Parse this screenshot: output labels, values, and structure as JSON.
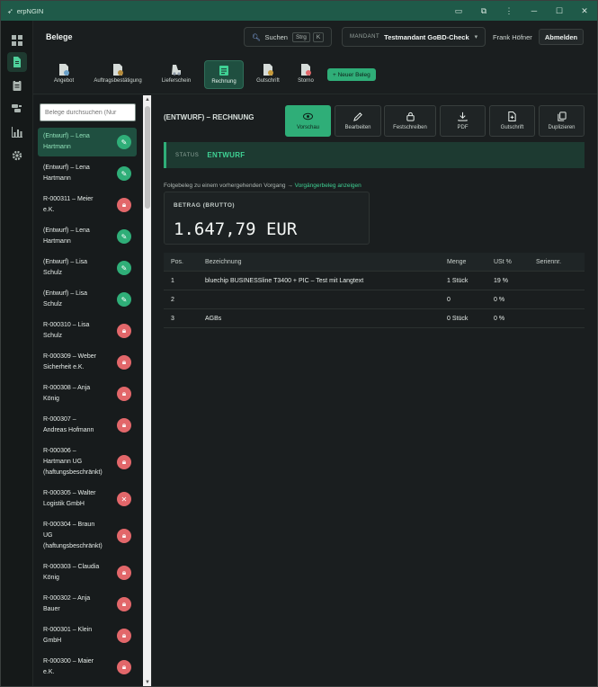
{
  "window": {
    "app_title": "erpNGIN",
    "controls": [
      "minimize",
      "maximize",
      "close"
    ]
  },
  "rail": {
    "items": [
      {
        "icon": "dashboard-icon"
      },
      {
        "icon": "document-icon",
        "active": true
      },
      {
        "icon": "clipboard-icon"
      },
      {
        "icon": "database-icon"
      },
      {
        "icon": "chart-icon"
      },
      {
        "icon": "gear-icon"
      }
    ]
  },
  "header": {
    "page_title": "Belege",
    "search": {
      "label": "Suchen",
      "shortcut_mod": "Strg",
      "shortcut_key": "K"
    },
    "mandant": {
      "label": "MANDANT",
      "value": "Testmandant GoBD-Check",
      "caret": "▾"
    },
    "user": "Frank Höfner",
    "logout": "Abmelden"
  },
  "doc_types": {
    "items": [
      {
        "label": "Angebot",
        "color": "#6aa0c8"
      },
      {
        "label": "Auftragsbestätigung",
        "color": "#b48a3a"
      },
      {
        "label": "Lieferschein",
        "color": "#8f9aa7"
      },
      {
        "label": "Rechnung",
        "color": "#3fd194",
        "active": true
      },
      {
        "label": "Gutschrift",
        "color": "#c79a3a"
      },
      {
        "label": "Storno",
        "color": "#e2676a"
      }
    ],
    "new_button": "+ Neuer Beleg"
  },
  "list": {
    "search_placeholder": "Belege durchsuchen (Nur",
    "items": [
      {
        "l1": "(Entwurf) – Lena",
        "l2": "Hartmann",
        "l3": "",
        "status": "edit",
        "selected": true
      },
      {
        "l1": "(Entwurf) – Lena",
        "l2": "Hartmann",
        "l3": "",
        "status": "edit"
      },
      {
        "l1": "R-000311 – Meier",
        "l2": "e.K.",
        "l3": "",
        "status": "lock"
      },
      {
        "l1": "(Entwurf) – Lena",
        "l2": "Hartmann",
        "l3": "",
        "status": "edit"
      },
      {
        "l1": "(Entwurf) – Lisa",
        "l2": "Schulz",
        "l3": "",
        "status": "edit"
      },
      {
        "l1": "(Entwurf) – Lisa",
        "l2": "Schulz",
        "l3": "",
        "status": "edit"
      },
      {
        "l1": "R-000310 – Lisa",
        "l2": "Schulz",
        "l3": "",
        "status": "lock"
      },
      {
        "l1": "R-000309 – Weber",
        "l2": "Sicherheit e.K.",
        "l3": "",
        "status": "lock"
      },
      {
        "l1": "R-000308 – Anja",
        "l2": "König",
        "l3": "",
        "status": "lock"
      },
      {
        "l1": "R-000307 –",
        "l2": "Andreas Hofmann",
        "l3": "",
        "status": "lock"
      },
      {
        "l1": "R-000306 –",
        "l2": "Hartmann UG",
        "l3": "(haftungsbeschränkt)",
        "status": "lock"
      },
      {
        "l1": "R-000305 – Walter",
        "l2": "Logistik GmbH",
        "l3": "",
        "status": "cancel"
      },
      {
        "l1": "R-000304 – Braun",
        "l2": "UG",
        "l3": "(haftungsbeschränkt)",
        "status": "lock"
      },
      {
        "l1": "R-000303 – Claudia",
        "l2": "König",
        "l3": "",
        "status": "lock"
      },
      {
        "l1": "R-000302 – Anja",
        "l2": "Bauer",
        "l3": "",
        "status": "lock"
      },
      {
        "l1": "R-000301 – Klein",
        "l2": "GmbH",
        "l3": "",
        "status": "lock"
      },
      {
        "l1": "R-000300 – Maier",
        "l2": "e.K.",
        "l3": "",
        "status": "lock"
      }
    ]
  },
  "main": {
    "title": "(ENTWURF) – RECHNUNG",
    "actions": [
      {
        "label": "Vorschau",
        "icon": "eye-icon",
        "primary": true
      },
      {
        "label": "Bearbeiten",
        "icon": "pencil-icon"
      },
      {
        "label": "Festschreiben",
        "icon": "lock-icon"
      },
      {
        "label": "PDF",
        "icon": "download-icon"
      },
      {
        "label": "Gutschrift",
        "icon": "file-plus-icon"
      },
      {
        "label": "Duplizieren",
        "icon": "copy-icon"
      }
    ],
    "status": {
      "label": "STATUS",
      "value": "ENTWURF"
    },
    "followup": {
      "text": "Folgebeleg zu einem vorhergehenden Vorgang →",
      "link": "Vorgängerbeleg anzeigen"
    },
    "amount": {
      "label": "BETRAG (BRUTTO)",
      "value": "1.647,79 EUR"
    },
    "table": {
      "headers": [
        "Pos.",
        "Bezeichnung",
        "Menge",
        "USt %",
        "Seriennr."
      ],
      "rows": [
        [
          "1",
          "bluechip BUSINESSline T3400 + PIC – Test mit Langtext",
          "1 Stück",
          "19 %",
          ""
        ],
        [
          "2",
          "",
          "0",
          "0 %",
          ""
        ],
        [
          "3",
          "AGBs",
          "0 Stück",
          "0 %",
          ""
        ]
      ]
    }
  }
}
